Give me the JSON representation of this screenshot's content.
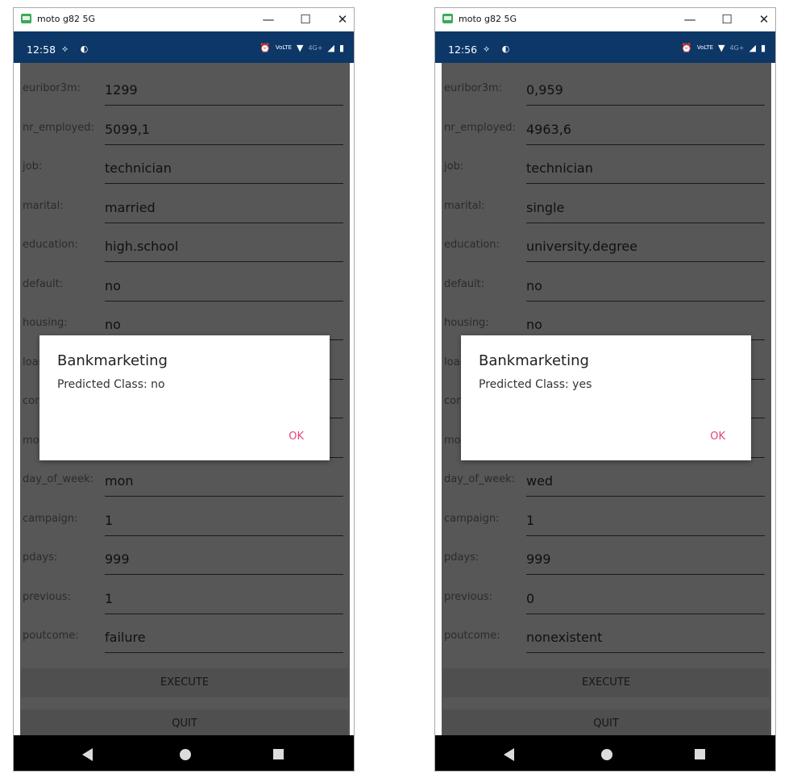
{
  "windows": [
    {
      "title": "moto g82 5G",
      "time": "12:58",
      "status_left_icons": "⟡ ◐",
      "status_right": {
        "alarm": "⏰",
        "volte": "VoLTE",
        "wifi": "▼",
        "network": "4G+",
        "signal": "◢",
        "battery": "▮"
      },
      "fields": [
        {
          "label": "euribor3m:",
          "value": "1299"
        },
        {
          "label": "nr_employed:",
          "value": "5099,1"
        },
        {
          "label": "job:",
          "value": "technician"
        },
        {
          "label": "marital:",
          "value": "married"
        },
        {
          "label": "education:",
          "value": "high.school"
        },
        {
          "label": "default:",
          "value": "no"
        },
        {
          "label": "housing:",
          "value": "no"
        },
        {
          "label": "loan:",
          "value": ""
        },
        {
          "label": "contact:",
          "value": ""
        },
        {
          "label": "month:",
          "value": ""
        },
        {
          "label": "day_of_week:",
          "value": "mon"
        },
        {
          "label": "campaign:",
          "value": "1"
        },
        {
          "label": "pdays:",
          "value": "999"
        },
        {
          "label": "previous:",
          "value": "1"
        },
        {
          "label": "poutcome:",
          "value": "failure"
        }
      ],
      "execute_label": "EXECUTE",
      "quit_label": "QUIT",
      "dialog": {
        "title": "Bankmarketing",
        "message": "Predicted Class: no",
        "ok_label": "OK"
      }
    },
    {
      "title": "moto g82 5G",
      "time": "12:56",
      "status_left_icons": "⟡ ◐",
      "status_right": {
        "alarm": "⏰",
        "volte": "VoLTE",
        "wifi": "▼",
        "network": "4G+",
        "signal": "◢",
        "battery": "▮"
      },
      "fields": [
        {
          "label": "euribor3m:",
          "value": "0,959"
        },
        {
          "label": "nr_employed:",
          "value": "4963,6"
        },
        {
          "label": "job:",
          "value": "technician"
        },
        {
          "label": "marital:",
          "value": "single"
        },
        {
          "label": "education:",
          "value": "university.degree"
        },
        {
          "label": "default:",
          "value": "no"
        },
        {
          "label": "housing:",
          "value": "no"
        },
        {
          "label": "loan:",
          "value": ""
        },
        {
          "label": "contact:",
          "value": ""
        },
        {
          "label": "month:",
          "value": ""
        },
        {
          "label": "day_of_week:",
          "value": "wed"
        },
        {
          "label": "campaign:",
          "value": "1"
        },
        {
          "label": "pdays:",
          "value": "999"
        },
        {
          "label": "previous:",
          "value": "0"
        },
        {
          "label": "poutcome:",
          "value": "nonexistent"
        }
      ],
      "execute_label": "EXECUTE",
      "quit_label": "QUIT",
      "dialog": {
        "title": "Bankmarketing",
        "message": "Predicted Class: yes",
        "ok_label": "OK"
      }
    }
  ],
  "window_controls": {
    "minimize": "—",
    "maximize": "☐",
    "close": "✕"
  },
  "colors": {
    "statusbar": "#0d3767",
    "overlay_screen": "#575757",
    "dialog_ok": "#e0457b"
  }
}
